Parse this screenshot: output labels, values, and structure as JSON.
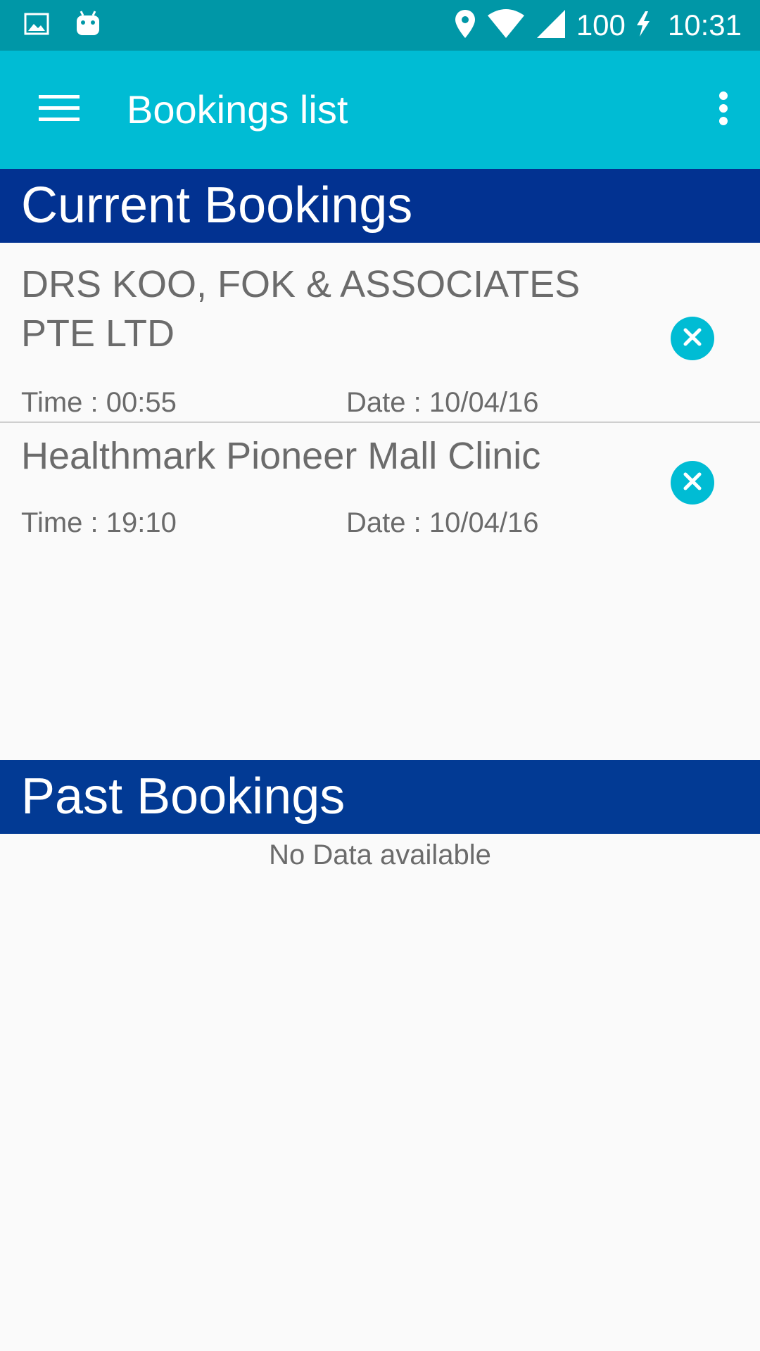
{
  "status_bar": {
    "icons_left": [
      "image-icon",
      "android-icon"
    ],
    "icons_right": [
      "location-icon",
      "wifi-icon",
      "cell-signal-icon",
      "battery-charging-icon"
    ],
    "battery": "100",
    "time": "10:31"
  },
  "app_bar": {
    "title": "Bookings list",
    "menu_icon": "menu-icon",
    "overflow_icon": "more-vert-icon",
    "color": "#00bcd4"
  },
  "current": {
    "heading": "Current Bookings",
    "items": [
      {
        "name": "DRS KOO, FOK & ASSOCIATES PTE LTD",
        "time": "Time : 00:55",
        "date": "Date : 10/04/16"
      },
      {
        "name": "Healthmark Pioneer Mall Clinic",
        "time": "Time : 19:10",
        "date": "Date : 10/04/16"
      }
    ]
  },
  "past": {
    "heading": "Past Bookings",
    "empty_text": "No Data available"
  },
  "colors": {
    "status_bar": "#0097a7",
    "section_header": "#023291",
    "accent": "#00bcd4"
  }
}
